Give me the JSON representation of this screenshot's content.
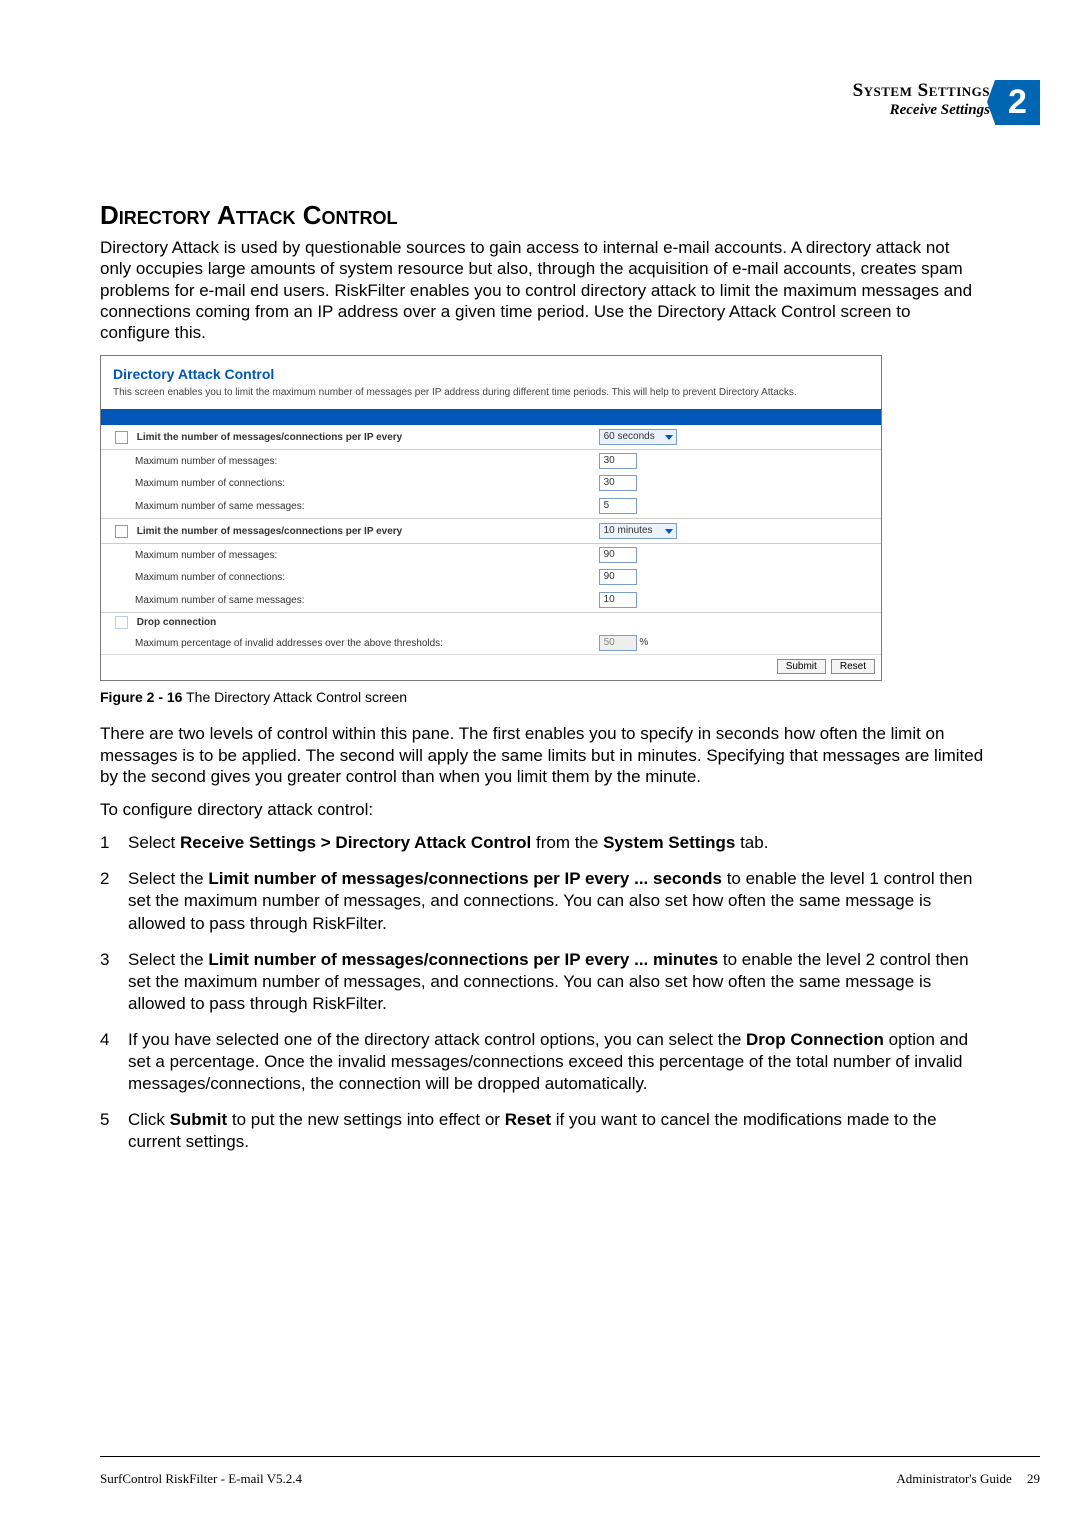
{
  "header": {
    "title": "System Settings",
    "subtitle": "Receive Settings",
    "chapter_no": "2"
  },
  "section_title": "Directory Attack Control",
  "intro": "Directory Attack is used by questionable sources to gain access to internal e-mail accounts. A directory attack not only occupies large amounts of system resource but also, through the acquisition of e-mail accounts, creates spam problems for e-mail end users. RiskFilter enables you to control directory attack to limit the maximum messages and connections coming from an IP address over a given time period. Use the Directory Attack Control screen to configure this.",
  "panel": {
    "title": "Directory Attack Control",
    "desc": "This screen enables you to limit the maximum number of messages per IP address during different time periods. This will help to prevent Directory Attacks.",
    "limit1_label": "Limit the number of messages/connections per IP every",
    "limit1_sel": "60 seconds",
    "max_msgs_label": "Maximum number of messages:",
    "max_conns_label": "Maximum number of connections:",
    "max_same_label": "Maximum number of same messages:",
    "limit1_max_msgs": "30",
    "limit1_max_conns": "30",
    "limit1_max_same": "5",
    "limit2_label": "Limit the number of messages/connections per IP every",
    "limit2_sel": "10 minutes",
    "limit2_max_msgs": "90",
    "limit2_max_conns": "90",
    "limit2_max_same": "10",
    "drop_label": "Drop connection",
    "drop_pct_label": "Maximum percentage of invalid addresses over the above thresholds:",
    "drop_pct_val": "50",
    "pct_sign": "%",
    "submit": "Submit",
    "reset": "Reset"
  },
  "figure_caption_bold": "Figure 2 - 16",
  "figure_caption_rest": " The Directory Attack Control screen",
  "para2": "There are two levels of control within this pane. The first enables you to specify in seconds how often the limit on messages is to be applied. The second will apply the same limits but in minutes. Specifying that messages are limited by the second gives you greater control than when you limit them by the minute.",
  "para3": "To configure directory attack control:",
  "steps": {
    "s1_a": "Select ",
    "s1_b": "Receive Settings > Directory Attack Control",
    "s1_c": " from the ",
    "s1_d": "System Settings",
    "s1_e": " tab.",
    "s2_a": "Select the ",
    "s2_b": "Limit number of messages/connections per IP every ... seconds",
    "s2_c": " to enable the level 1 control then set the maximum number of messages, and connections. You can also set how often the same message is allowed to pass through RiskFilter.",
    "s3_a": "Select the ",
    "s3_b": "Limit number of messages/connections per IP every ... minutes",
    "s3_c": " to enable the level 2 control then set the maximum number of messages, and connections. You can also set how often the same message is allowed to pass through RiskFilter.",
    "s4_a": "If you have selected one of the directory attack control options, you can select the ",
    "s4_b": "Drop Connection",
    "s4_c": " option and set a percentage. Once the invalid messages/connections exceed this percentage of the total number of invalid messages/connections, the connection will be dropped automatically.",
    "s5_a": "Click ",
    "s5_b": "Submit",
    "s5_c": " to put the new settings into effect or ",
    "s5_d": "Reset",
    "s5_e": " if you want to cancel the modifications made to the current settings."
  },
  "footer": {
    "left": "SurfControl RiskFilter - E-mail V5.2.4",
    "right": "Administrator's Guide",
    "page": "29"
  }
}
